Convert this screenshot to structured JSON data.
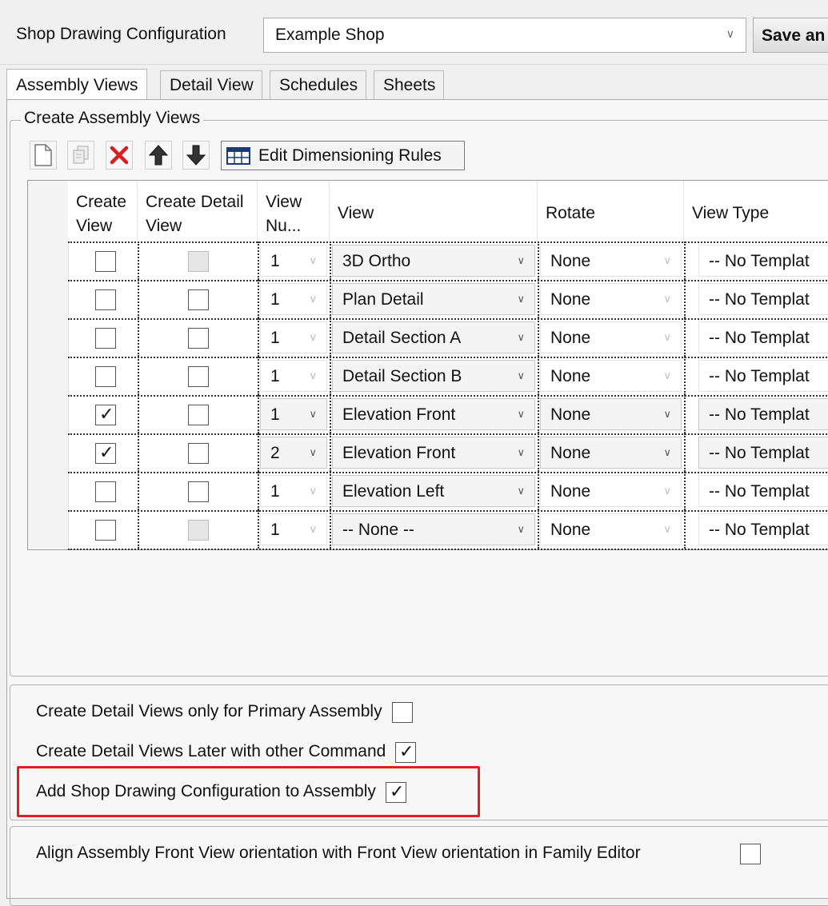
{
  "config": {
    "label": "Shop Drawing Configuration",
    "value": "Example Shop",
    "save_label": "Save an"
  },
  "tabs": [
    {
      "label": "Assembly Views",
      "active": true
    },
    {
      "label": "Detail View",
      "active": false
    },
    {
      "label": "Schedules",
      "active": false
    },
    {
      "label": "Sheets",
      "active": false
    }
  ],
  "group": {
    "title": "Create Assembly Views",
    "toolbar": {
      "icons": [
        "new-icon",
        "copy-icon",
        "delete-icon",
        "move-up-icon",
        "move-down-icon"
      ],
      "edit_dim_label": "Edit Dimensioning Rules"
    }
  },
  "table": {
    "headers": {
      "create_view": "Create View",
      "create_detail": "Create Detail View",
      "view_num": "View Nu...",
      "view": "View",
      "rotate": "Rotate",
      "view_type": "View Type"
    },
    "rows": [
      {
        "create_view": false,
        "create_detail": false,
        "detail_enabled": false,
        "view_num": "1",
        "view": "3D Ortho",
        "rotate": "None",
        "view_type": "-- No Templat",
        "enabled": false
      },
      {
        "create_view": false,
        "create_detail": false,
        "detail_enabled": true,
        "view_num": "1",
        "view": "Plan Detail",
        "rotate": "None",
        "view_type": "-- No Templat",
        "enabled": false
      },
      {
        "create_view": false,
        "create_detail": false,
        "detail_enabled": true,
        "view_num": "1",
        "view": "Detail Section A",
        "rotate": "None",
        "view_type": "-- No Templat",
        "enabled": false
      },
      {
        "create_view": false,
        "create_detail": false,
        "detail_enabled": true,
        "view_num": "1",
        "view": "Detail Section B",
        "rotate": "None",
        "view_type": "-- No Templat",
        "enabled": false
      },
      {
        "create_view": true,
        "create_detail": false,
        "detail_enabled": true,
        "view_num": "1",
        "view": "Elevation Front",
        "rotate": "None",
        "view_type": "-- No Templat",
        "enabled": true
      },
      {
        "create_view": true,
        "create_detail": false,
        "detail_enabled": true,
        "view_num": "2",
        "view": "Elevation Front",
        "rotate": "None",
        "view_type": "-- No Templat",
        "enabled": true
      },
      {
        "create_view": false,
        "create_detail": false,
        "detail_enabled": true,
        "view_num": "1",
        "view": "Elevation Left",
        "rotate": "None",
        "view_type": "-- No Templat",
        "enabled": false
      },
      {
        "create_view": false,
        "create_detail": false,
        "detail_enabled": false,
        "view_num": "1",
        "view": "-- None --",
        "rotate": "None",
        "view_type": "-- No Templat",
        "enabled": false
      }
    ]
  },
  "options": [
    {
      "label": "Create Detail Views only for Primary Assembly",
      "checked": false
    },
    {
      "label": "Create Detail Views Later with other Command",
      "checked": true
    },
    {
      "label": "Add Shop Drawing Configuration to Assembly",
      "checked": true
    }
  ],
  "align_option": {
    "label": "Align Assembly Front View orientation with Front View orientation in Family Editor",
    "checked": false
  },
  "colors": {
    "highlight": "#e02020",
    "delete": "#d62020",
    "panel": "#f7f7f7"
  }
}
